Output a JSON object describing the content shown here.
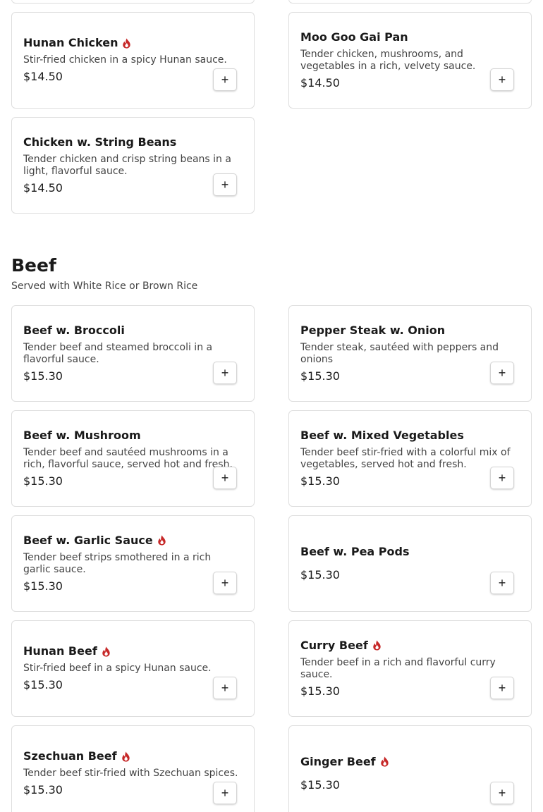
{
  "colors": {
    "spicy": "#c62828",
    "card_border": "#dedede"
  },
  "add_button_label": "+",
  "spicy_icon": "flame-icon",
  "chicken_items": [
    {
      "name": "Hunan Chicken",
      "description": "Stir-fried chicken in a spicy Hunan sauce.",
      "price": "$14.50",
      "spicy": true
    },
    {
      "name": "Moo Goo Gai Pan",
      "description": "Tender chicken, mushrooms, and vegetables in a rich, velvety sauce.",
      "price": "$14.50",
      "spicy": false
    },
    {
      "name": "Chicken w. String Beans",
      "description": "Tender chicken and crisp string beans in a light, flavorful sauce.",
      "price": "$14.50",
      "spicy": false
    }
  ],
  "beef": {
    "title": "Beef",
    "subtitle": "Served with White Rice or Brown Rice",
    "items": [
      {
        "name": "Beef w. Broccoli",
        "description": "Tender beef and steamed broccoli in a flavorful sauce.",
        "price": "$15.30",
        "spicy": false
      },
      {
        "name": "Pepper Steak w. Onion",
        "description": "Tender steak, sautéed with peppers and onions",
        "price": "$15.30",
        "spicy": false
      },
      {
        "name": "Beef w. Mushroom",
        "description": "Tender beef and sautéed mushrooms in a rich, flavorful sauce, served hot and fresh.",
        "price": "$15.30",
        "spicy": false
      },
      {
        "name": "Beef w. Mixed Vegetables",
        "description": "Tender beef stir-fried with a colorful mix of vegetables, served hot and fresh.",
        "price": "$15.30",
        "spicy": false
      },
      {
        "name": "Beef w. Garlic Sauce",
        "description": "Tender beef strips smothered in a rich garlic sauce.",
        "price": "$15.30",
        "spicy": true
      },
      {
        "name": "Beef w. Pea Pods",
        "description": "",
        "price": "$15.30",
        "spicy": false
      },
      {
        "name": "Hunan Beef",
        "description": "Stir-fried beef in a spicy Hunan sauce.",
        "price": "$15.30",
        "spicy": true
      },
      {
        "name": "Curry Beef",
        "description": "Tender beef in a rich and flavorful curry sauce.",
        "price": "$15.30",
        "spicy": true
      },
      {
        "name": "Szechuan Beef",
        "description": "Tender beef stir-fried with Szechuan spices.",
        "price": "$15.30",
        "spicy": true
      },
      {
        "name": "Ginger Beef",
        "description": "",
        "price": "$15.30",
        "spicy": true
      }
    ]
  }
}
